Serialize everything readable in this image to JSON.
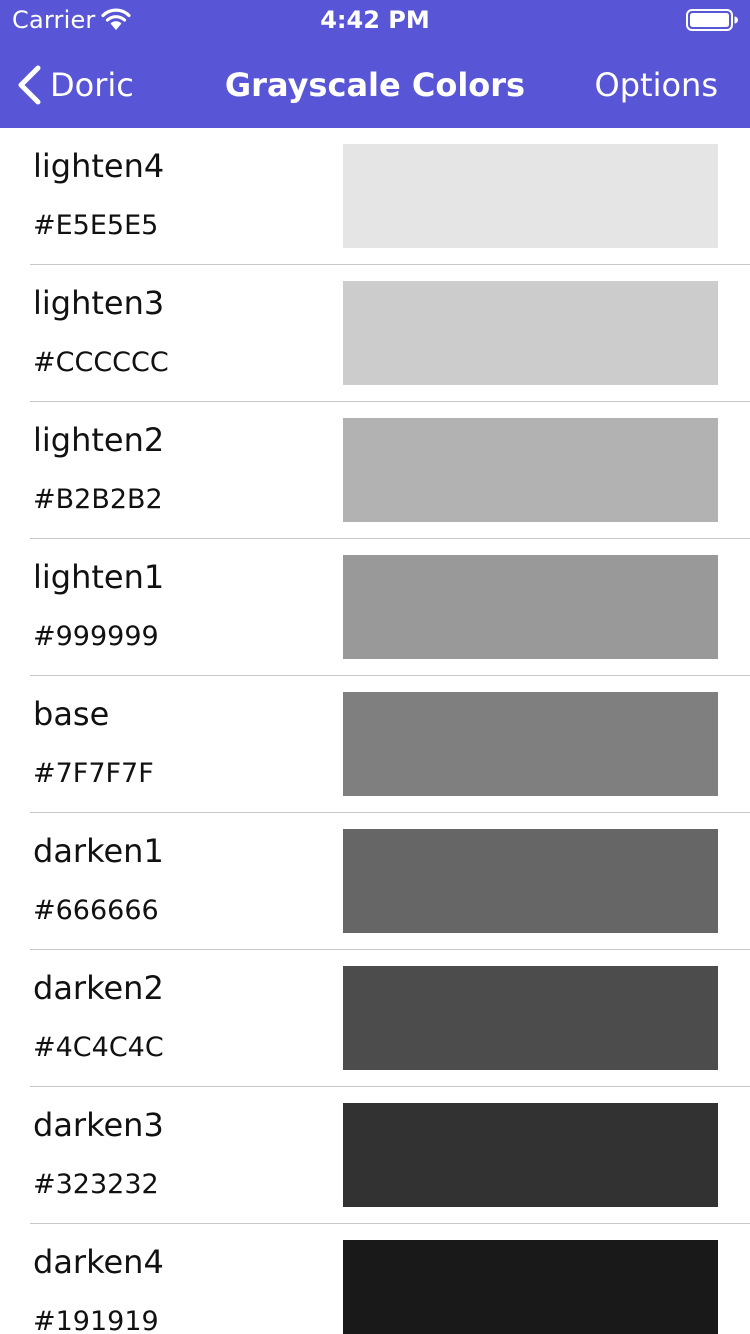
{
  "status_bar": {
    "carrier": "Carrier",
    "time": "4:42 PM",
    "wifi_icon": "wifi-icon",
    "battery_icon": "battery-icon"
  },
  "nav_bar": {
    "back_label": "Doric",
    "title": "Grayscale Colors",
    "options_label": "Options",
    "background_color": "#5856D6"
  },
  "colors": [
    {
      "name": "lighten4",
      "hex": "#E5E5E5"
    },
    {
      "name": "lighten3",
      "hex": "#CCCCCC"
    },
    {
      "name": "lighten2",
      "hex": "#B2B2B2"
    },
    {
      "name": "lighten1",
      "hex": "#999999"
    },
    {
      "name": "base",
      "hex": "#7F7F7F"
    },
    {
      "name": "darken1",
      "hex": "#666666"
    },
    {
      "name": "darken2",
      "hex": "#4C4C4C"
    },
    {
      "name": "darken3",
      "hex": "#323232"
    },
    {
      "name": "darken4",
      "hex": "#191919"
    }
  ]
}
